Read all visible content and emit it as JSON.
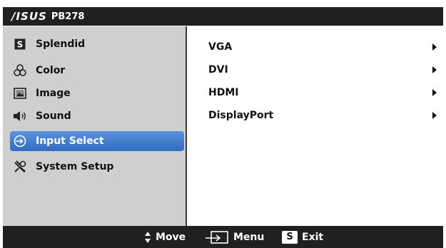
{
  "title": {
    "brand": "/ISUS",
    "model": "PB278"
  },
  "menu": [
    {
      "label": "Splendid",
      "icon": "splendid-s-icon"
    },
    {
      "label": "Color",
      "icon": "color-circles-icon"
    },
    {
      "label": "Image",
      "icon": "image-icon"
    },
    {
      "label": "Sound",
      "icon": "speaker-icon"
    },
    {
      "label": "Input Select",
      "icon": "input-select-icon",
      "selected": true
    },
    {
      "label": "System Setup",
      "icon": "system-setup-icon"
    }
  ],
  "options": [
    {
      "label": "VGA"
    },
    {
      "label": "DVI"
    },
    {
      "label": "HDMI"
    },
    {
      "label": "DisplayPort"
    }
  ],
  "footer": {
    "move_label": "Move",
    "menu_label": "Menu",
    "exit_label": "Exit",
    "exit_key": "S"
  },
  "colors": {
    "selection": "#3d7bd0",
    "sidebar_bg": "#cfcfcf",
    "bar_bg": "#202020"
  }
}
